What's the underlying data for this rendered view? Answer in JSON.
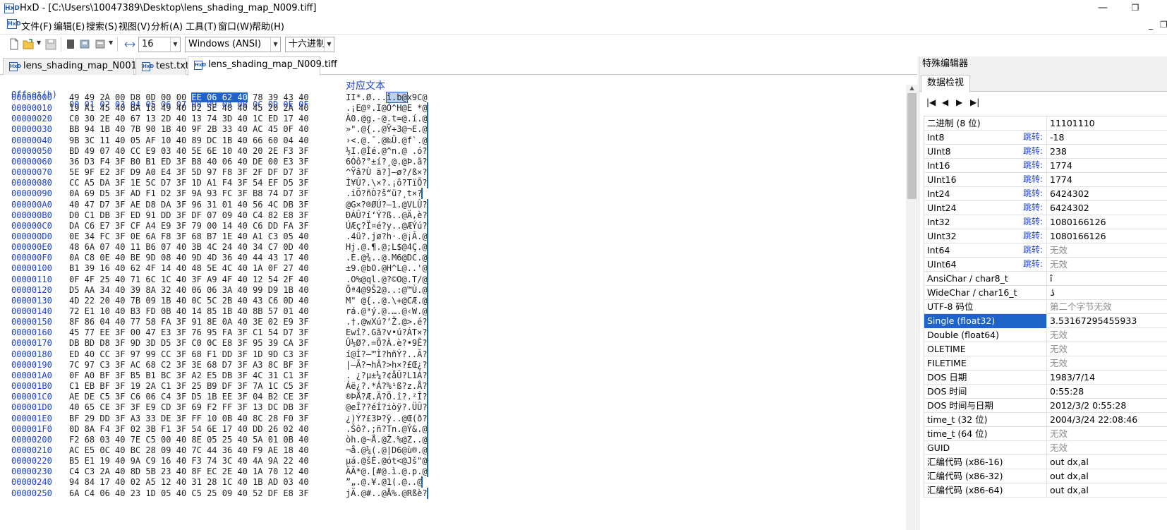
{
  "window": {
    "title": "HxD - [C:\\Users\\10047389\\Desktop\\lens_shading_map_N009.tiff]",
    "app_icon": "HxD",
    "minimize": "—",
    "maximize": "❐",
    "mdi_minimize": "_",
    "mdi_restore": "❐"
  },
  "menu": [
    {
      "label": "文件(F)"
    },
    {
      "label": "编辑(E)"
    },
    {
      "label": "搜索(S)"
    },
    {
      "label": "视图(V)"
    },
    {
      "label": "分析(A)"
    },
    {
      "label": "工具(T)"
    },
    {
      "label": "窗口(W)"
    },
    {
      "label": "帮助(H)"
    }
  ],
  "toolbar": {
    "bytes_per_row": "16",
    "charset": "Windows (ANSI)",
    "offset_base": "十六进制"
  },
  "tabs": [
    {
      "label": "lens_shading_map_N001.tiff"
    },
    {
      "label": "test.txt"
    },
    {
      "label": "lens_shading_map_N009.tiff"
    }
  ],
  "hex": {
    "offset_header": "Offset(h)",
    "columns_header": "00 01 02 03 04 05 06 07 08 09 0A 0B 0C 0D 0E 0F",
    "text_header": "对应文本",
    "rows": [
      {
        "off": "00000000",
        "pre": "49 49 2A 00 D8 0D 00 00 ",
        "sel": "EE 06 62 40",
        "post": " 78 39 43 40",
        "tpre": "II*.Ø...",
        "tsel": "î.b@",
        "tpost": "x9C@"
      },
      {
        "off": "00000010",
        "pre": "19 A1 45 40 BA 18 49 40 D2 5E 48 40 45 20 2A 40",
        "sel": "",
        "post": "",
        "tpre": ".¡E@º.I@Ò^H@E *@",
        "tsel": "",
        "tpost": ""
      },
      {
        "off": "00000020",
        "pre": "C0 30 2E 40 67 13 2D 40 13 74 3D 40 1C ED 17 40",
        "sel": "",
        "post": "",
        "tpre": "À0.@g.-@.t=@.í.@",
        "tsel": "",
        "tpost": ""
      },
      {
        "off": "00000030",
        "pre": "BB 94 1B 40 7B 90 1B 40 9F 2B 33 40 AC 45 0F 40",
        "sel": "",
        "post": "",
        "tpre": "»\".@{..@Ÿ+3@¬E.@",
        "tsel": "",
        "tpost": ""
      },
      {
        "off": "00000040",
        "pre": "9B 3C 11 40 05 AF 10 40 89 DC 1B 40 66 60 04 40",
        "sel": "",
        "post": "",
        "tpre": "›<.@.¯.@‰Ü.@f`.@",
        "tsel": "",
        "tpost": ""
      },
      {
        "off": "00000050",
        "pre": "BD 49 07 40 CC E9 03 40 5E 6E 10 40 20 2E F3 3F",
        "sel": "",
        "post": "",
        "tpre": "½I.@Ìé.@^n.@ .ó?",
        "tsel": "",
        "tpost": ""
      },
      {
        "off": "00000060",
        "pre": "36 D3 F4 3F B0 B1 ED 3F B8 40 06 40 DE 00 E3 3F",
        "sel": "",
        "post": "",
        "tpre": "6Óô?°±í?¸@.@Þ.ã?",
        "tsel": "",
        "tpost": ""
      },
      {
        "off": "00000070",
        "pre": "5E 9F E2 3F D9 A0 E4 3F 5D 97 F8 3F 2F DF D7 3F",
        "sel": "",
        "post": "",
        "tpre": "^Ÿâ?Ù ä?]—ø?/ß×?",
        "tsel": "",
        "tpost": ""
      },
      {
        "off": "00000080",
        "pre": "CC A5 DA 3F 1E 5C D7 3F 1D A1 F4 3F 54 EF D5 3F",
        "sel": "",
        "post": "",
        "tpre": "Ì¥Ú?.\\×?.¡ô?TïÕ?",
        "tsel": "",
        "tpost": ""
      },
      {
        "off": "00000090",
        "pre": "0A 69 D5 3F AD F1 D2 3F 9A 93 FC 3F B8 74 D7 3F",
        "sel": "",
        "post": "",
        "tpre": ".iÕ?­ñÒ?š“ü?¸t×?",
        "tsel": "",
        "tpost": ""
      },
      {
        "off": "000000A0",
        "pre": "40 47 D7 3F AE D8 DA 3F 96 31 01 40 56 4C DB 3F",
        "sel": "",
        "post": "",
        "tpre": "@G×?®ØÚ?–1.@VLÛ?",
        "tsel": "",
        "tpost": ""
      },
      {
        "off": "000000B0",
        "pre": "D0 C1 DB 3F ED 91 DD 3F DF 07 09 40 C4 82 E8 3F",
        "sel": "",
        "post": "",
        "tpre": "ÐÁÛ?í‘Ý?ß..@Ä‚è?",
        "tsel": "",
        "tpost": ""
      },
      {
        "off": "000000C0",
        "pre": "DA C6 E7 3F CF A4 E9 3F 79 00 14 40 C6 DD FA 3F",
        "sel": "",
        "post": "",
        "tpre": "ÚÆç?Ï¤é?y..@ÆÝú?",
        "tsel": "",
        "tpost": ""
      },
      {
        "off": "000000D0",
        "pre": "0E 34 FC 3F 0E 6A F8 3F 68 B7 1E 40 A1 C3 05 40",
        "sel": "",
        "post": "",
        "tpre": ".4ü?.jø?h·.@¡Ã.@",
        "tsel": "",
        "tpost": ""
      },
      {
        "off": "000000E0",
        "pre": "48 6A 07 40 11 B6 07 40 3B 4C 24 40 34 C7 0D 40",
        "sel": "",
        "post": "",
        "tpre": "Hj.@.¶.@;L$@4Ç.@",
        "tsel": "",
        "tpost": ""
      },
      {
        "off": "000000F0",
        "pre": "0A C8 0E 40 BE 9D 08 40 9D 4D 36 40 44 43 17 40",
        "sel": "",
        "post": "",
        "tpre": ".È.@¾..@.M6@DC.@",
        "tsel": "",
        "tpost": ""
      },
      {
        "off": "00000100",
        "pre": "B1 39 16 40 62 4F 14 40 48 5E 4C 40 1A 0F 27 40",
        "sel": "",
        "post": "",
        "tpre": "±9.@bO.@H^L@..'@",
        "tsel": "",
        "tpost": ""
      },
      {
        "off": "00000110",
        "pre": "0F 4F 25 40 71 6C 1C 40 3F A9 4F 40 12 54 2F 40",
        "sel": "",
        "post": "",
        "tpre": ".O%@ql.@?©O@.T/@",
        "tsel": "",
        "tpost": ""
      },
      {
        "off": "00000120",
        "pre": "D5 AA 34 40 39 8A 32 40 06 06 3A 40 99 D9 1B 40",
        "sel": "",
        "post": "",
        "tpre": "Õª4@9Š2@..:@™Ù.@",
        "tsel": "",
        "tpost": ""
      },
      {
        "off": "00000130",
        "pre": "4D 22 20 40 7B 09 1B 40 0C 5C 2B 40 43 C6 0D 40",
        "sel": "",
        "post": "",
        "tpre": "M\" @{..@.\\+@CÆ.@",
        "tsel": "",
        "tpost": ""
      },
      {
        "off": "00000140",
        "pre": "72 E1 10 40 B3 FD 0B 40 14 85 1B 40 8B 57 01 40",
        "sel": "",
        "post": "",
        "tpre": "rá.@³ý.@.….@‹W.@",
        "tsel": "",
        "tpost": ""
      },
      {
        "off": "00000150",
        "pre": "8F 86 04 40 77 58 FA 3F 91 8E 0A 40 3E 02 E9 3F",
        "sel": "",
        "post": "",
        "tpre": ".†.@wXú?‘Ž.@>.é?",
        "tsel": "",
        "tpost": ""
      },
      {
        "off": "00000160",
        "pre": "45 77 EE 3F 00 47 E3 3F 76 95 FA 3F C1 54 D7 3F",
        "sel": "",
        "post": "",
        "tpre": "Ewî?.Gã?v•ú?ÁT×?",
        "tsel": "",
        "tpost": ""
      },
      {
        "off": "00000170",
        "pre": "DB BD D8 3F 9D 3D D5 3F C0 0C E8 3F 95 39 CA 3F",
        "sel": "",
        "post": "",
        "tpre": "Û½Ø?.=Õ?À.è?•9Ê?",
        "tsel": "",
        "tpost": ""
      },
      {
        "off": "00000180",
        "pre": "ED 40 CC 3F 97 99 CC 3F 68 F1 DD 3F 1D 9D C3 3F",
        "sel": "",
        "post": "",
        "tpre": "í@Ì?—™Ì?hñÝ?..Ã?",
        "tsel": "",
        "tpost": ""
      },
      {
        "off": "00000190",
        "pre": "7C 97 C3 3F AC 68 C2 3F 3E 68 D7 3F A3 8C BF 3F",
        "sel": "",
        "post": "",
        "tpre": "|—Ã?¬hÂ?>h×?£Œ¿?",
        "tsel": "",
        "tpost": ""
      },
      {
        "off": "000001A0",
        "pre": "0F A0 BF 3F B5 B1 BC 3F A2 E5 DB 3F 4C 31 C1 3F",
        "sel": "",
        "post": "",
        "tpre": ". ¿?µ±¼?¢åÛ?L1Á?",
        "tsel": "",
        "tpost": ""
      },
      {
        "off": "000001B0",
        "pre": "C1 EB BF 3F 19 2A C1 3F 25 B9 DF 3F 7A 1C C5 3F",
        "sel": "",
        "post": "",
        "tpre": "Áë¿?.*Á?%¹ß?z.Å?",
        "tsel": "",
        "tpost": ""
      },
      {
        "off": "000001C0",
        "pre": "AE DE C5 3F C6 06 C4 3F D5 1B EE 3F 04 B2 CE 3F",
        "sel": "",
        "post": "",
        "tpre": "®ÞÅ?Æ.Ä?Õ.î?.²Î?",
        "tsel": "",
        "tpost": ""
      },
      {
        "off": "000001D0",
        "pre": "40 65 CE 3F 3F E9 CD 3F 69 F2 FF 3F 13 DC DB 3F",
        "sel": "",
        "post": "",
        "tpre": "@eÎ??éÍ?iòÿ?.ÜÛ?",
        "tsel": "",
        "tpost": ""
      },
      {
        "off": "000001E0",
        "pre": "BF 29 DD 3F A3 33 DE 3F FF 10 0B 40 8C 28 F0 3F",
        "sel": "",
        "post": "",
        "tpre": "¿)Ý?£3Þ?ÿ..@Œ(ð?",
        "tsel": "",
        "tpost": ""
      },
      {
        "off": "000001F0",
        "pre": "0D 8A F4 3F 02 3B F1 3F 54 6E 17 40 DD 26 02 40",
        "sel": "",
        "post": "",
        "tpre": ".Šô?.;ñ?Tn.@Ý&.@",
        "tsel": "",
        "tpost": ""
      },
      {
        "off": "00000200",
        "pre": "F2 68 03 40 7E C5 00 40 8E 05 25 40 5A 01 0B 40",
        "sel": "",
        "post": "",
        "tpre": "òh.@~Å.@Ž.%@Z..@",
        "tsel": "",
        "tpost": ""
      },
      {
        "off": "00000210",
        "pre": "AC E5 0C 40 BC 28 09 40 7C 44 36 40 F9 AE 18 40",
        "sel": "",
        "post": "",
        "tpre": "¬å.@¼(.@|D6@ù®.@",
        "tsel": "",
        "tpost": ""
      },
      {
        "off": "00000220",
        "pre": "B5 E1 19 40 9A C9 16 40 F3 74 3C 40 4A 9A 22 40",
        "sel": "",
        "post": "",
        "tpre": "µá.@šÉ.@ót<@Jš\"@",
        "tsel": "",
        "tpost": ""
      },
      {
        "off": "00000230",
        "pre": "C4 C3 2A 40 8D 5B 23 40 8F EC 2E 40 1A 70 12 40",
        "sel": "",
        "post": "",
        "tpre": "ÄÃ*@.[#@.ì.@.p.@",
        "tsel": "",
        "tpost": ""
      },
      {
        "off": "00000240",
        "pre": "94 84 17 40 02 A5 12 40 31 28 1C 40 1B AD 03 40",
        "sel": "",
        "post": "",
        "tpre": "”„.@.¥.@1(.@.­.@",
        "tsel": "",
        "tpost": ""
      },
      {
        "off": "00000250",
        "pre": "6A C4 06 40 23 1D 05 40 C5 25 09 40 52 DF E8 3F",
        "sel": "",
        "post": "",
        "tpre": "jÄ.@#..@Å%.@Rßè?",
        "tsel": "",
        "tpost": ""
      }
    ]
  },
  "panel": {
    "title": "特殊编辑器",
    "tab": "数据检视",
    "nav": [
      "|◀",
      "◀",
      "▶",
      "▶|"
    ],
    "rows": [
      {
        "label": "二进制 (8 位)",
        "jump": "",
        "value": "11101110",
        "na": false
      },
      {
        "label": "Int8",
        "jump": "跳转:",
        "value": "-18",
        "na": false
      },
      {
        "label": "UInt8",
        "jump": "跳转:",
        "value": "238",
        "na": false
      },
      {
        "label": "Int16",
        "jump": "跳转:",
        "value": "1774",
        "na": false
      },
      {
        "label": "UInt16",
        "jump": "跳转:",
        "value": "1774",
        "na": false
      },
      {
        "label": "Int24",
        "jump": "跳转:",
        "value": "6424302",
        "na": false
      },
      {
        "label": "UInt24",
        "jump": "跳转:",
        "value": "6424302",
        "na": false
      },
      {
        "label": "Int32",
        "jump": "跳转:",
        "value": "1080166126",
        "na": false
      },
      {
        "label": "UInt32",
        "jump": "跳转:",
        "value": "1080166126",
        "na": false
      },
      {
        "label": "Int64",
        "jump": "跳转:",
        "value": "无效",
        "na": true
      },
      {
        "label": "UInt64",
        "jump": "跳转:",
        "value": "无效",
        "na": true
      },
      {
        "label": "AnsiChar / char8_t",
        "jump": "",
        "value": "î",
        "na": false
      },
      {
        "label": "WideChar / char16_t",
        "jump": "",
        "value": "ۮ",
        "na": false
      },
      {
        "label": "UTF-8 码位",
        "jump": "",
        "value": "第二个字节无效",
        "na": true
      },
      {
        "label": "Single (float32)",
        "jump": "",
        "value": "3.53167295455933",
        "na": false,
        "hl": true
      },
      {
        "label": "Double (float64)",
        "jump": "",
        "value": "无效",
        "na": true
      },
      {
        "label": "OLETIME",
        "jump": "",
        "value": "无效",
        "na": true
      },
      {
        "label": "FILETIME",
        "jump": "",
        "value": "无效",
        "na": true
      },
      {
        "label": "DOS 日期",
        "jump": "",
        "value": "1983/7/14",
        "na": false
      },
      {
        "label": "DOS 时间",
        "jump": "",
        "value": "0:55:28",
        "na": false
      },
      {
        "label": "DOS 时间与日期",
        "jump": "",
        "value": "2012/3/2 0:55:28",
        "na": false
      },
      {
        "label": "time_t (32 位)",
        "jump": "",
        "value": "2004/3/24 22:08:46",
        "na": false
      },
      {
        "label": "time_t (64 位)",
        "jump": "",
        "value": "无效",
        "na": true
      },
      {
        "label": "GUID",
        "jump": "",
        "value": "无效",
        "na": true
      },
      {
        "label": "汇编代码 (x86-16)",
        "jump": "",
        "value": "out dx,al",
        "na": false
      },
      {
        "label": "汇编代码 (x86-32)",
        "jump": "",
        "value": "out dx,al",
        "na": false
      },
      {
        "label": "汇编代码 (x86-64)",
        "jump": "",
        "value": "out dx,al",
        "na": false
      }
    ]
  }
}
